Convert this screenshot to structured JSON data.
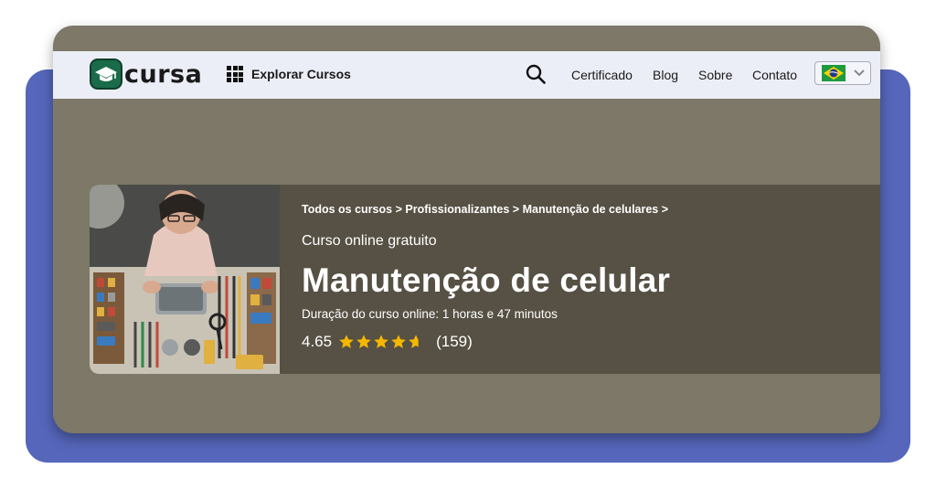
{
  "brand": {
    "name": "cursa"
  },
  "nav": {
    "explore_label": "Explorar Cursos",
    "links": [
      "Certificado",
      "Blog",
      "Sobre",
      "Contato"
    ],
    "language_flag": "brazil-flag-icon"
  },
  "breadcrumb": {
    "items": [
      "Todos os cursos",
      "Profissionalizantes",
      "Manutenção de celulares"
    ],
    "separator": ">"
  },
  "course": {
    "kicker": "Curso online gratuito",
    "title": "Manutenção de celular",
    "duration": "Duração do curso online: 1 horas e 47 minutos",
    "rating": "4.65",
    "rating_value": 4.65,
    "reviews": "(159)"
  },
  "colors": {
    "backdrop": "#5566bb",
    "window": "#7d7868",
    "hero_panel": "#565144",
    "star": "#f5b800",
    "logo_green": "#1a6b4a"
  }
}
